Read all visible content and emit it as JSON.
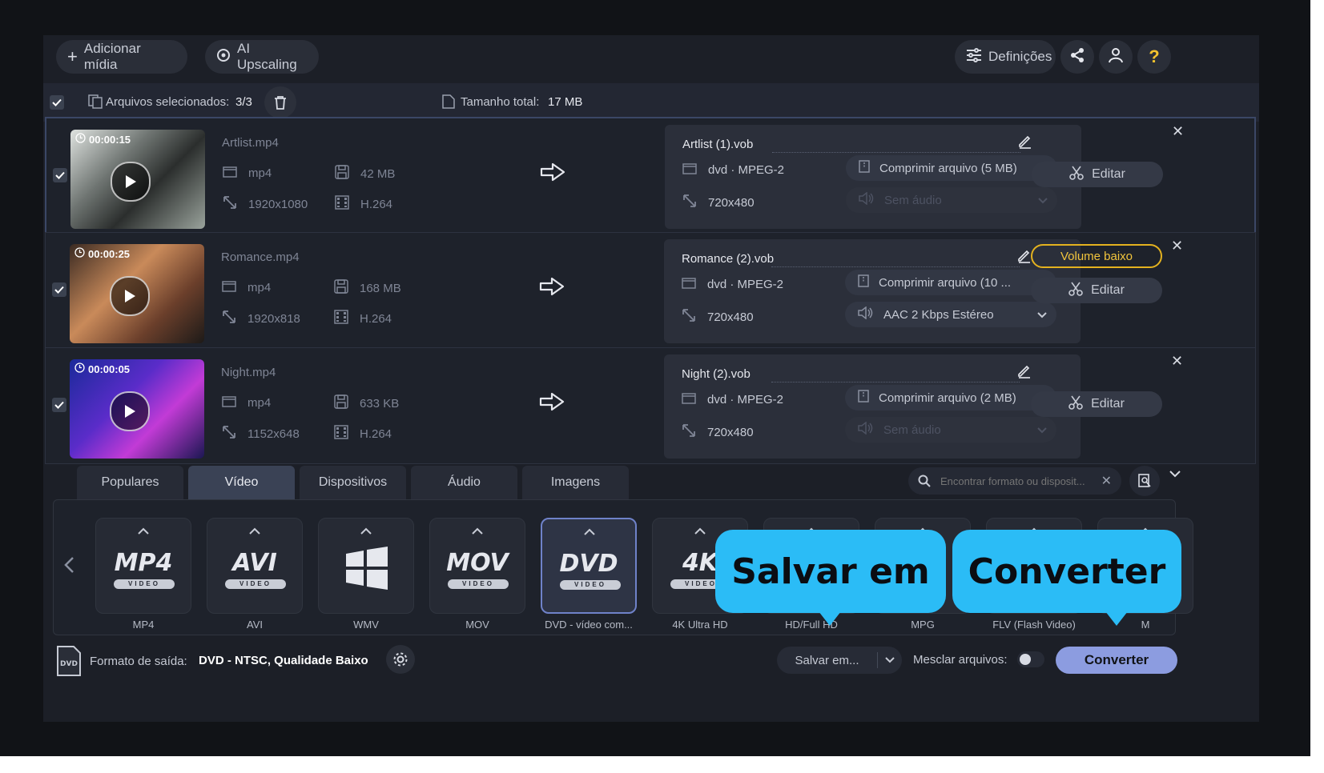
{
  "toolbar": {
    "add_media": "Adicionar mídia",
    "ai_upscaling": "AI Upscaling",
    "settings": "Definições",
    "help": "?"
  },
  "selection": {
    "label": "Arquivos selecionados:",
    "count": "3/3",
    "total_label": "Tamanho total:",
    "total_value": "17 MB"
  },
  "files": [
    {
      "duration": "00:00:15",
      "source_name": "Artlist.mp4",
      "source_format": "mp4",
      "source_size": "42 MB",
      "source_resolution": "1920x1080",
      "source_codec": "H.264",
      "output_name": "Artlist (1).vob",
      "output_format": "dvd · MPEG-2",
      "output_resolution": "720x480",
      "compress": "Comprimir arquivo (5 MB)",
      "audio": "Sem áudio",
      "warning": "",
      "edit": "Editar"
    },
    {
      "duration": "00:00:25",
      "source_name": "Romance.mp4",
      "source_format": "mp4",
      "source_size": "168 MB",
      "source_resolution": "1920x818",
      "source_codec": "H.264",
      "output_name": "Romance (2).vob",
      "output_format": "dvd · MPEG-2",
      "output_resolution": "720x480",
      "compress": "Comprimir arquivo (10 ...",
      "audio": "AAC 2 Kbps Estéreo",
      "warning": "Volume baixo",
      "edit": "Editar"
    },
    {
      "duration": "00:00:05",
      "source_name": "Night.mp4",
      "source_format": "mp4",
      "source_size": "633 KB",
      "source_resolution": "1152x648",
      "source_codec": "H.264",
      "output_name": "Night (2).vob",
      "output_format": "dvd · MPEG-2",
      "output_resolution": "720x480",
      "compress": "Comprimir arquivo (2 MB)",
      "audio": "Sem áudio",
      "warning": "",
      "edit": "Editar"
    }
  ],
  "tabs": [
    "Populares",
    "Vídeo",
    "Dispositivos",
    "Áudio",
    "Imagens"
  ],
  "search": {
    "placeholder": "Encontrar formato ou disposit..."
  },
  "formats": [
    {
      "label": "MP4",
      "logo": "MP4",
      "sub": "VIDEO"
    },
    {
      "label": "AVI",
      "logo": "AVI",
      "sub": "VIDEO"
    },
    {
      "label": "WMV",
      "logo": "",
      "sub": ""
    },
    {
      "label": "MOV",
      "logo": "MOV",
      "sub": "VIDEO"
    },
    {
      "label": "DVD - vídeo com...",
      "logo": "DVD",
      "sub": "VIDEO"
    },
    {
      "label": "4K Ultra HD",
      "logo": "4K",
      "sub": "VIDEO"
    },
    {
      "label": "HD/Full HD",
      "logo": "",
      "sub": ""
    },
    {
      "label": "MPG",
      "logo": "",
      "sub": ""
    },
    {
      "label": "FLV (Flash Video)",
      "logo": "",
      "sub": ""
    },
    {
      "label": "M",
      "logo": "",
      "sub": ""
    }
  ],
  "bottom": {
    "output_label": "Formato de saída:",
    "output_value": "DVD - NTSC, Qualidade Baixo",
    "save_to": "Salvar em...",
    "merge_label": "Mesclar arquivos:",
    "convert": "Converter"
  },
  "callouts": {
    "save": "Salvar em",
    "convert": "Converter"
  },
  "colors": {
    "accent": "#8c9ce0",
    "callout": "#2bbcf6",
    "warning": "#e4b21f",
    "help": "#f3c22e"
  }
}
